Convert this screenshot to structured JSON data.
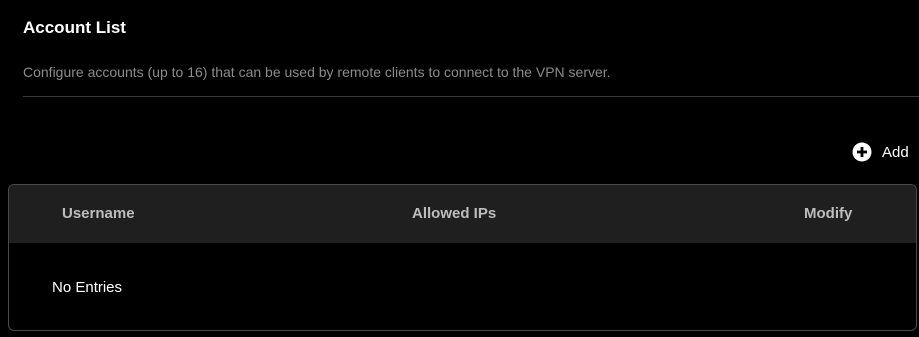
{
  "section": {
    "title": "Account List",
    "description": "Configure accounts (up to 16) that can be used by remote clients to connect to the VPN server."
  },
  "toolbar": {
    "add_label": "Add",
    "add_icon": "plus-circle-icon"
  },
  "table": {
    "columns": [
      "Username",
      "Allowed IPs",
      "Modify"
    ],
    "empty_text": "No Entries",
    "rows": []
  },
  "colors": {
    "background": "#000000",
    "header_background": "#1f1f1f",
    "description_text": "#8c8c8c",
    "border": "#4a4a4a"
  }
}
